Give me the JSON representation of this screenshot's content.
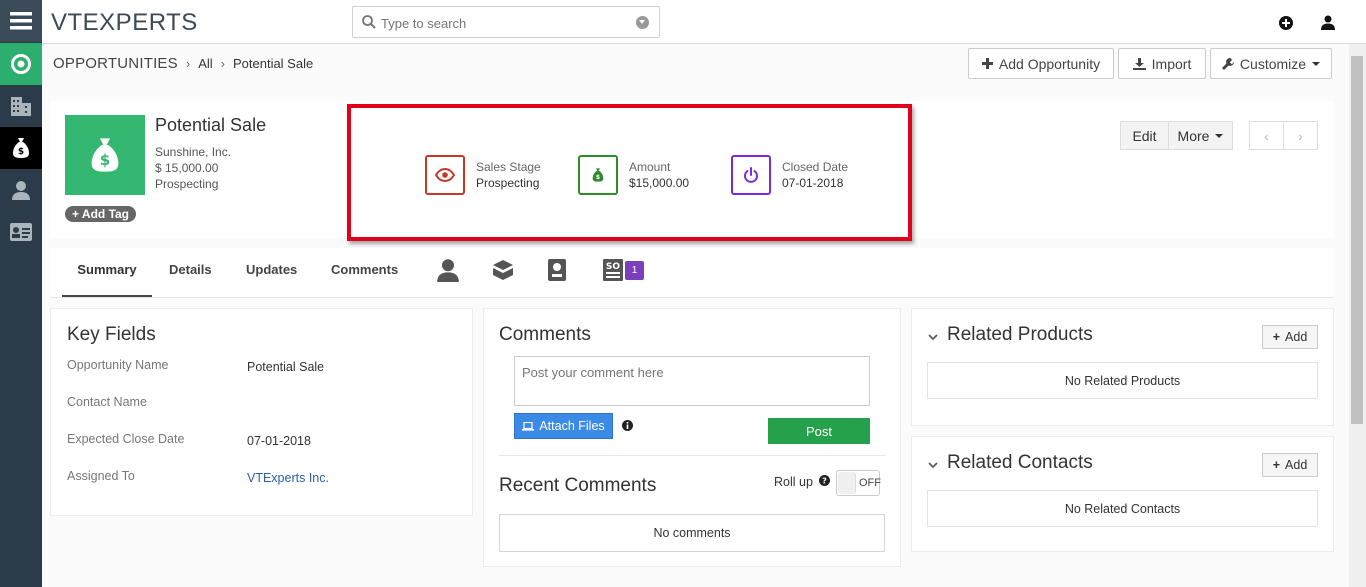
{
  "app": {
    "logo_text": "VTEXPERTS"
  },
  "search": {
    "placeholder": "Type to search"
  },
  "breadcrumb": {
    "module": "OPPORTUNITIES",
    "filter": "All",
    "current": "Potential Sale"
  },
  "actions": {
    "add_opportunity": "Add Opportunity",
    "import": "Import",
    "customize": "Customize"
  },
  "record": {
    "title": "Potential Sale",
    "organization": "Sunshine, Inc.",
    "amount": "$ 15,000.00",
    "stage": "Prospecting",
    "add_tag": "Add Tag"
  },
  "header_fields": [
    {
      "label": "Sales Stage",
      "value": "Prospecting",
      "color": "#c0392b"
    },
    {
      "label": "Amount",
      "value": "$15,000.00",
      "color": "#2e8b2e"
    },
    {
      "label": "Closed Date",
      "value": "07-01-2018",
      "color": "#7a2ad8"
    }
  ],
  "header_buttons": {
    "edit": "Edit",
    "more": "More"
  },
  "tabs": [
    "Summary",
    "Details",
    "Updates",
    "Comments"
  ],
  "tab_badge": "1",
  "key_fields": {
    "title": "Key Fields",
    "rows": [
      {
        "label": "Opportunity Name",
        "value": "Potential Sale"
      },
      {
        "label": "Contact Name",
        "value": ""
      },
      {
        "label": "Expected Close Date",
        "value": "07-01-2018"
      },
      {
        "label": "Assigned To",
        "value": "VTExperts Inc."
      }
    ]
  },
  "comments": {
    "title": "Comments",
    "placeholder": "Post your comment here",
    "attach": "Attach Files",
    "post": "Post",
    "recent_title": "Recent Comments",
    "rollup": "Roll up",
    "toggle": "OFF",
    "empty": "No comments"
  },
  "related_products": {
    "title": "Related Products",
    "add": "Add",
    "empty": "No Related Products"
  },
  "related_contacts": {
    "title": "Related Contacts",
    "add": "Add",
    "empty": "No Related Contacts"
  }
}
